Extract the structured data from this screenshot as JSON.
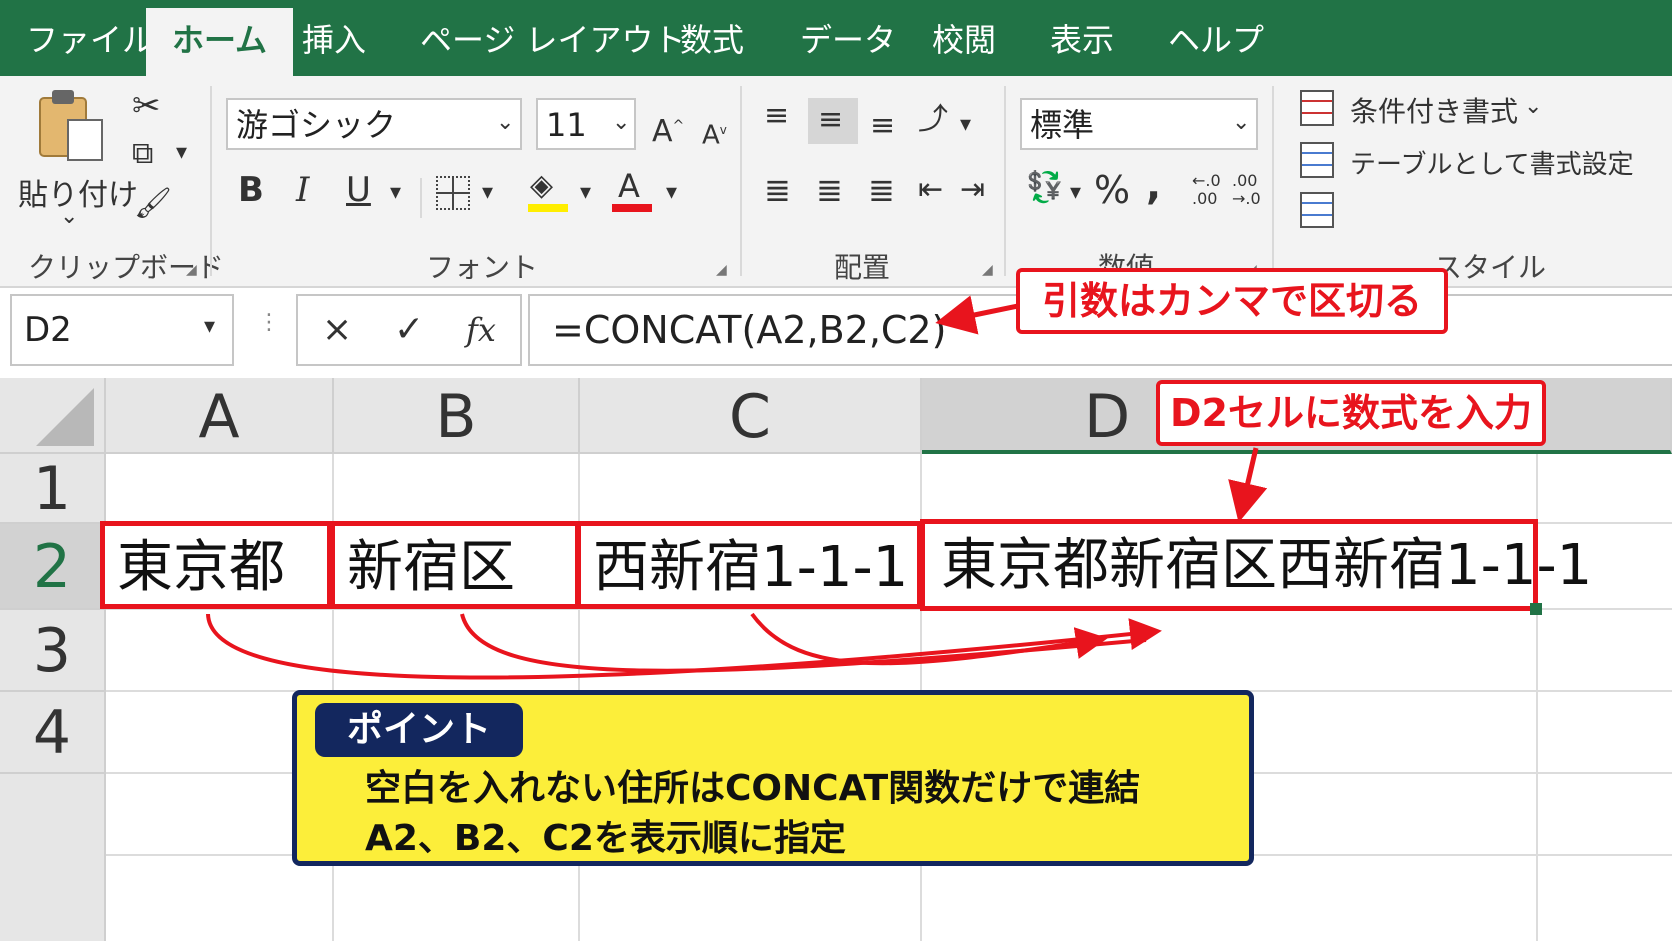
{
  "tabs": [
    "ファイル",
    "ホーム",
    "挿入",
    "ページ レイアウト",
    "数式",
    "データ",
    "校閲",
    "表示",
    "ヘルプ"
  ],
  "ribbon": {
    "clipboard": {
      "paste_label": "貼り付け",
      "group_label": "クリップボード"
    },
    "font": {
      "font_name": "游ゴシック",
      "font_size": "11",
      "group_label": "フォント",
      "bold": "B",
      "italic": "I",
      "underline": "U",
      "font_color_glyph": "A",
      "grow": "A",
      "shrink": "A"
    },
    "alignment": {
      "group_label": "配置"
    },
    "number": {
      "format": "標準",
      "percent": "%",
      "comma": ",",
      "group_label": "数値"
    },
    "styles": {
      "conditional": "条件付き書式",
      "table": "テーブルとして書式設定",
      "group_label": "スタイル"
    }
  },
  "formula_bar": {
    "name_box": "D2",
    "cancel": "×",
    "enter": "✓",
    "fx": "fx",
    "formula": "=CONCAT(A2,B2,C2)"
  },
  "columns": [
    "A",
    "B",
    "C",
    "D"
  ],
  "rows": [
    "1",
    "2",
    "3",
    "4"
  ],
  "cells": {
    "A2": "東京都",
    "B2": "新宿区",
    "C2": "西新宿1-1-1",
    "D2": "東京都新宿区西新宿1-1-1"
  },
  "callouts": {
    "args": "引数はカンマで区切る",
    "d2": "D2セルに数式を入力"
  },
  "point": {
    "badge": "ポイント",
    "line1": "空白を入れない住所はCONCAT関数だけで連結",
    "line2": "A2、B2、C2を表示順に指定"
  },
  "colors": {
    "excel_green": "#217346",
    "callout_red": "#e8141d",
    "point_yellow": "#fcee3a",
    "point_navy": "#13275e"
  }
}
